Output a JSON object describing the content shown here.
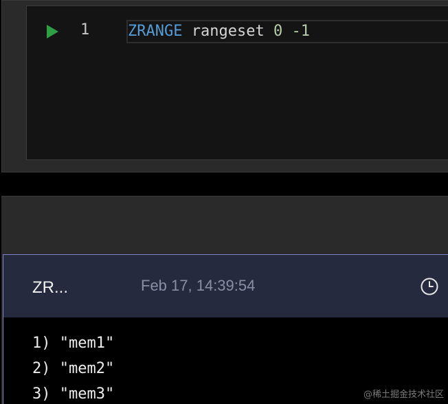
{
  "editor": {
    "line_number": "1",
    "code": {
      "keyword": "ZRANGE",
      "key": "rangeset",
      "start": "0",
      "stop": "-1"
    }
  },
  "result": {
    "command_short": "ZR...",
    "timestamp": "Feb 17, 14:39:54",
    "rows": [
      {
        "index": "1)",
        "value": "\"mem1\""
      },
      {
        "index": "2)",
        "value": "\"mem2\""
      },
      {
        "index": "3)",
        "value": "\"mem3\""
      }
    ]
  },
  "watermark": "@稀土掘金技术社区",
  "colors": {
    "run": "#2ea043",
    "keyword": "#569cd6",
    "number": "#b5cea8",
    "card_border": "#7f86c8",
    "card_header": "#262a3f"
  },
  "icons": {
    "run": "play-icon",
    "history": "clock-icon"
  }
}
